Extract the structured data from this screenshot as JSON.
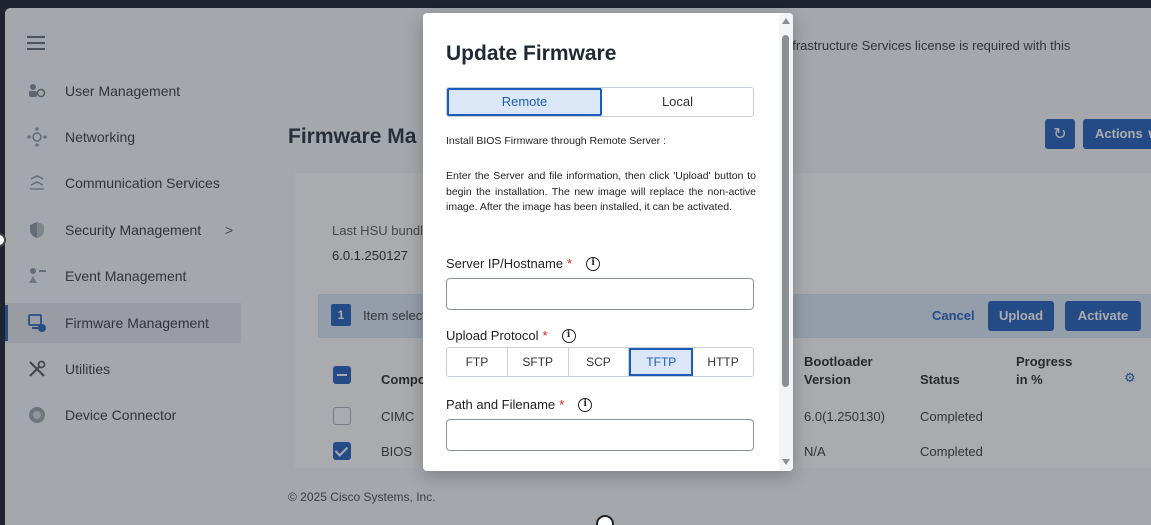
{
  "sidebar": {
    "items": [
      {
        "label": "User Management",
        "icon": "users-icon"
      },
      {
        "label": "Networking",
        "icon": "network-icon"
      },
      {
        "label": "Communication Services",
        "icon": "communication-icon"
      },
      {
        "label": "Security Management",
        "icon": "shield-icon",
        "chevron": ">"
      },
      {
        "label": "Event Management",
        "icon": "event-icon"
      },
      {
        "label": "Firmware Management",
        "icon": "firmware-icon",
        "active": true
      },
      {
        "label": "Utilities",
        "icon": "tools-icon"
      },
      {
        "label": "Device Connector",
        "icon": "device-connector-icon"
      }
    ]
  },
  "main": {
    "banner_text": "nfrastructure Services license is required with this",
    "page_title": "Firmware Ma",
    "actions_label": "Actions",
    "hsu_label": "Last HSU bundle",
    "hsu_value": "6.0.1.250127",
    "selection": {
      "count": "1",
      "text": "Item select"
    },
    "cancel_label": "Cancel",
    "upload_label": "Upload",
    "activate_label": "Activate",
    "table": {
      "headers": {
        "component": "Compo",
        "bootloader": "Bootloader Version",
        "status": "Status",
        "progress": "Progress in %"
      },
      "rows": [
        {
          "component": "CIMC",
          "bootloader": "6.0(1.250130)",
          "status": "Completed",
          "checked": false
        },
        {
          "component": "BIOS",
          "bootloader": "N/A",
          "status": "Completed",
          "checked": true
        }
      ]
    },
    "footer": "© 2025 Cisco Systems, Inc."
  },
  "modal": {
    "title": "Update Firmware",
    "source_tabs": [
      {
        "label": "Remote",
        "active": true
      },
      {
        "label": "Local",
        "active": false
      }
    ],
    "subtitle": "Install BIOS Firmware through Remote Server :",
    "description": "Enter the Server and file information, then click 'Upload' button to begin the installation. The new image will replace the non-active image. After the image has been installed, it can be activated.",
    "server_label": "Server IP/Hostname",
    "server_value": "",
    "protocol_label": "Upload Protocol",
    "protocols": [
      {
        "label": "FTP",
        "active": false
      },
      {
        "label": "SFTP",
        "active": false
      },
      {
        "label": "SCP",
        "active": false
      },
      {
        "label": "TFTP",
        "active": true
      },
      {
        "label": "HTTP",
        "active": false
      }
    ],
    "path_label": "Path and Filename",
    "path_value": "",
    "required_mark": "*",
    "info_glyph": "i"
  },
  "colors": {
    "accent": "#1d5bb8",
    "required": "#d0271d",
    "selection_bg": "#dbe7f6"
  }
}
